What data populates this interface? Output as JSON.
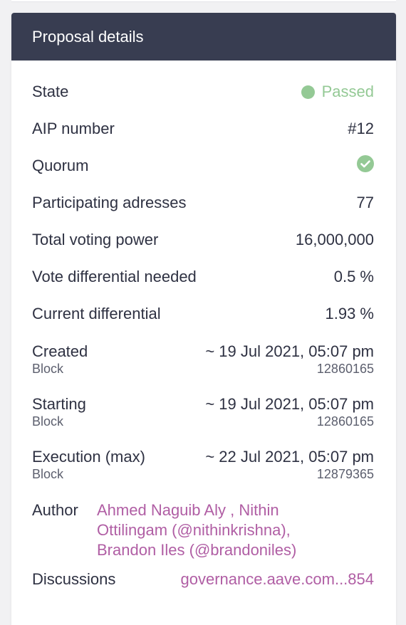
{
  "card": {
    "title": "Proposal details"
  },
  "rows": {
    "state": {
      "label": "State",
      "value": "Passed",
      "status_color": "#94c995"
    },
    "aip": {
      "label": "AIP number",
      "value": "#12"
    },
    "quorum": {
      "label": "Quorum",
      "icon": "check-circle-icon"
    },
    "participating": {
      "label": "Participating adresses",
      "value": "77"
    },
    "total_power": {
      "label": "Total voting power",
      "value": "16,000,000"
    },
    "vote_diff_needed": {
      "label": "Vote differential needed",
      "value": "0.5 %"
    },
    "current_diff": {
      "label": "Current differential",
      "value": "1.93 %"
    }
  },
  "blocks": {
    "created": {
      "label": "Created",
      "sublabel": "Block",
      "date": "~ 19 Jul 2021, 05:07 pm",
      "block": "12860165"
    },
    "starting": {
      "label": "Starting",
      "sublabel": "Block",
      "date": "~ 19 Jul 2021, 05:07 pm",
      "block": "12860165"
    },
    "execution": {
      "label": "Execution (max)",
      "sublabel": "Block",
      "date": "~ 22 Jul 2021, 05:07 pm",
      "block": "12879365"
    }
  },
  "author": {
    "label": "Author",
    "value": "Ahmed Naguib Aly , Nithin Ottilingam (@nithinkrishna), Brandon Iles (@brandoniles)"
  },
  "discussions": {
    "label": "Discussions",
    "value": "governance.aave.com...854"
  },
  "colors": {
    "header_bg": "#383d51",
    "link": "#b05ea4",
    "success": "#94c995"
  }
}
